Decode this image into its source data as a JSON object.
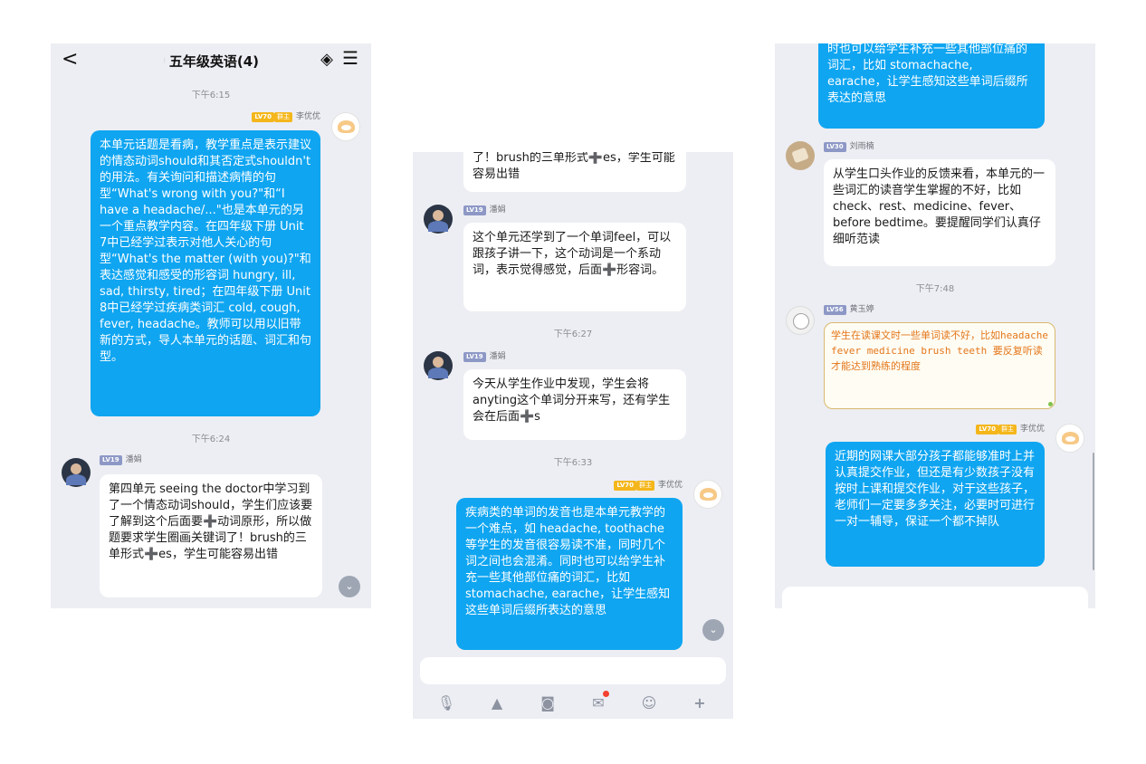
{
  "panel1": {
    "header": {
      "back_glyph": "<",
      "ghost_glyph": "⁾",
      "title": "五年级英语(4)",
      "icon1_glyph": "◈",
      "menu_glyph": "☰"
    },
    "ts1": "下午6:15",
    "msg1": {
      "owner_badge": "群主",
      "level": "LV70",
      "name": "李优优",
      "text": "本单元话题是看病，教学重点是表示建议的情态动词should和其否定式shouldn't的用法。有关询问和描述病情的句型“What's wrong with you?\"和“I have a headache/...\"也是本单元的另一个重点教学内容。在四年级下册 Unit 7中已经学过表示对他人关心的句型“What's the matter (with you)?\"和表达感觉和感受的形容词 hungry, ill, sad, thirsty, tired；在四年级下册 Unit 8中已经学过疾病类词汇 cold, cough, fever, headache。教师可以用以旧带新的方式，导人本单元的话题、词汇和句型。"
    },
    "ts2": "下午6:24",
    "msg2": {
      "level": "LV19",
      "name": "潘娟",
      "text": "第四单元 seeing the doctor中学习到了一个情态动词should，学生们应该要了解到这个后面要➕动词原形，所以做题要求学生圈画关键词了！brush的三单形式➕es，学生可能容易出错"
    },
    "scroll_glyph": "⌄"
  },
  "panel2": {
    "msg_top": "了！brush的三单形式➕es，学生可能容易出错",
    "msg1": {
      "level": "LV19",
      "name": "潘娟",
      "text": "这个单元还学到了一个单词feel，可以跟孩子讲一下，这个动词是一个系动词，表示觉得感觉，后面➕形容词。"
    },
    "ts1": "下午6:27",
    "msg2": {
      "level": "LV19",
      "name": "潘娟",
      "text": "今天从学生作业中发现，学生会将anyting这个单词分开来写，还有学生会在后面➕s"
    },
    "ts2": "下午6:33",
    "msg3": {
      "owner_badge": "群主",
      "level": "LV70",
      "name": "李优优",
      "text": "疾病类的单词的发音也是本单元教学的一个难点，如 headache, toothache等学生的发音很容易读不准，同时几个词之间也会混淆。同时也可以给学生补充一些其他部位痛的词汇，比如 stomachache, earache，让学生感知这些单词后缀所表达的意思"
    },
    "scroll_glyph": "⌄",
    "toolbar": {
      "mic_glyph": "🎙",
      "image_glyph": "▲",
      "camera_glyph": "◙",
      "redpacket_glyph": "✉",
      "emoji_glyph": "☺",
      "plus_glyph": "+"
    }
  },
  "panel3": {
    "msg_top": "时也可以给学生补充一些其他部位痛的词汇，比如 stomachache, earache，让学生感知这些单词后缀所表达的意思",
    "msg1": {
      "level": "LV30",
      "name": "刘雨楠",
      "text": "从学生口头作业的反馈来看，本单元的一些词汇的读音学生掌握的不好，比如 check、rest、medicine、fever、before bedtime。要提醒同学们认真仔细听范读"
    },
    "ts1": "下午7:48",
    "msg2": {
      "level": "LV56",
      "name": "黄玉婷",
      "text": "学生在读课文时一些单词读不好，比如headache fever medicine brush teeth 要反复听读才能达到熟练的程度"
    },
    "msg3": {
      "owner_badge": "群主",
      "level": "LV70",
      "name": "李优优",
      "text": "近期的网课大部分孩子都能够准时上并认真提交作业，但还是有少数孩子没有按时上课和提交作业，对于这些孩子，老师们一定要多多关注，必要时可进行一对一辅导，保证一个都不掉队"
    }
  }
}
